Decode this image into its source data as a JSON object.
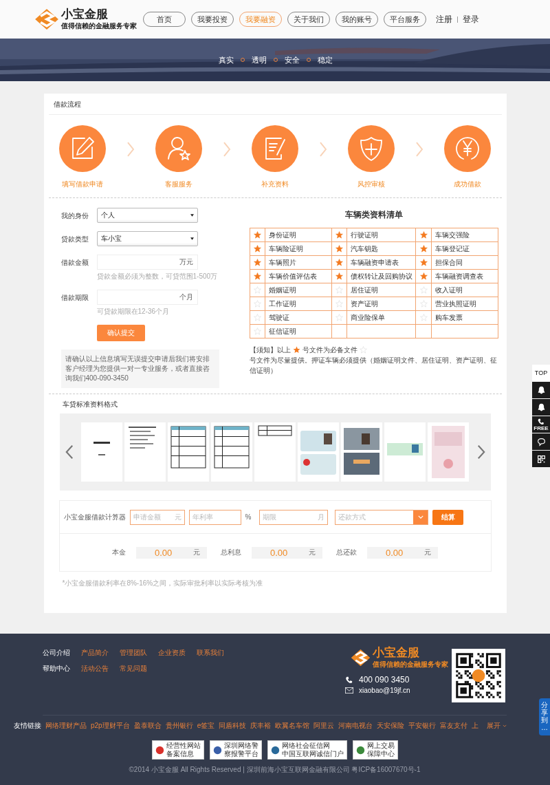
{
  "header": {
    "logo": {
      "name": "小宝金服",
      "slogan": "值得信赖的金融服务专家"
    },
    "nav": [
      {
        "label": "首页",
        "selected": false
      },
      {
        "label": "我要投资",
        "selected": false
      },
      {
        "label": "我要融资",
        "selected": true
      },
      {
        "label": "关于我们",
        "selected": false
      },
      {
        "label": "我的账号",
        "selected": false
      },
      {
        "label": "平台服务",
        "selected": false
      }
    ],
    "register": "注册",
    "login": "登录"
  },
  "banner": {
    "tags": [
      "真实",
      "透明",
      "安全",
      "稳定"
    ]
  },
  "process": {
    "title": "借款流程",
    "steps": [
      {
        "kind": "edit",
        "label": "填写借款申请"
      },
      {
        "kind": "service",
        "label": "客服服务"
      },
      {
        "kind": "document",
        "label": "补充资料"
      },
      {
        "kind": "shield",
        "label": "风控审核"
      },
      {
        "kind": "yen",
        "label": "成功借款"
      }
    ]
  },
  "form": {
    "fields": [
      {
        "kind": "select",
        "label": "我的身份",
        "value": "个人"
      },
      {
        "kind": "select",
        "label": "贷款类型",
        "value": "车小宝"
      },
      {
        "kind": "input",
        "label": "借款金额",
        "unit": "万元",
        "hint": "贷款金额必须为整数，可贷范围1-500万"
      },
      {
        "kind": "input",
        "label": "借款期限",
        "unit": "个月",
        "hint": "可贷款期限在12-36个月"
      }
    ],
    "submit": "确认提交",
    "info": "请确认以上信息填写无误提交申请后我们将安排客户经理为您提供一对一专业服务，或者直接咨询我们400-090-3450"
  },
  "checklist": {
    "title": "车辆类资料清单",
    "items": [
      {
        "label": "身份证明",
        "required": true
      },
      {
        "label": "行驶证明",
        "required": true
      },
      {
        "label": "车辆交强险",
        "required": true
      },
      {
        "label": "车辆险证明",
        "required": true
      },
      {
        "label": "汽车钥匙",
        "required": true
      },
      {
        "label": "车辆登记证",
        "required": true
      },
      {
        "label": "车辆照片",
        "required": true
      },
      {
        "label": "车辆融资申请表",
        "required": true
      },
      {
        "label": "担保合同",
        "required": true
      },
      {
        "label": "车辆价值评估表",
        "required": true
      },
      {
        "label": "债权转让及回购协议",
        "required": true
      },
      {
        "label": "车辆融资调查表",
        "required": true
      },
      {
        "label": "婚姻证明",
        "required": false
      },
      {
        "label": "居住证明",
        "required": false
      },
      {
        "label": "收入证明",
        "required": false
      },
      {
        "label": "工作证明",
        "required": false
      },
      {
        "label": "资产证明",
        "required": false
      },
      {
        "label": "营业执照证明",
        "required": false
      },
      {
        "label": "驾驶证",
        "required": false
      },
      {
        "label": "商业险保单",
        "required": false
      },
      {
        "label": "购车发票",
        "required": false
      },
      {
        "label": "征信证明",
        "required": false
      }
    ],
    "notice": {
      "before": "【须知】以上",
      "middle": "号文件为必备文件",
      "after": "号文件为尽量提供。押证车辆必须提供（婚姻证明文件、居住证明、资产证明、征信证明）"
    }
  },
  "gallery": {
    "title": "车贷标准资料格式"
  },
  "calculator": {
    "title": "小宝金服借款计算器",
    "amount": {
      "placeholder": "申请金额",
      "unit": "元"
    },
    "rate": {
      "placeholder": "年利率",
      "unit": "%"
    },
    "term": {
      "placeholder": "期限",
      "unit": "月"
    },
    "method": {
      "placeholder": "还款方式"
    },
    "button": "结算",
    "results": [
      {
        "label": "本金",
        "value": "0.00",
        "unit": "元"
      },
      {
        "label": "总利息",
        "value": "0.00",
        "unit": "元"
      },
      {
        "label": "总还款",
        "value": "0.00",
        "unit": "元"
      }
    ],
    "note": "*小宝金服借款利率在8%-16%之间，实际审批利率以实际考核为准"
  },
  "footer": {
    "link_rows": [
      {
        "head": "公司介绍",
        "links": [
          "产品简介",
          "管理团队",
          "企业资质",
          "联系我们"
        ]
      },
      {
        "head": "帮助中心",
        "links": [
          "活动公告",
          "常见问题"
        ]
      }
    ],
    "logo": {
      "name": "小宝金服",
      "slogan": "值得信赖的金融服务专家"
    },
    "phone": "400 090 3450",
    "email": "xiaobao@19jf.cn",
    "friends": {
      "head": "友情链接",
      "links": [
        "网络理财产品",
        "p2p理财平台",
        "盈泰联合",
        "贵州银行",
        "e签宝",
        "同盾科技",
        "庆丰裕",
        "欧翼名车馆",
        "阿里云",
        "河南电视台",
        "天安保险",
        "平安银行",
        "富友支付",
        "上"
      ],
      "more": "展开"
    },
    "badges": [
      {
        "lines": [
          "经营性网站",
          "备案信息"
        ]
      },
      {
        "lines": [
          "深圳网络警",
          "察报警平台"
        ]
      },
      {
        "lines": [
          "网络社会征信网",
          "中国互联网诚信门户"
        ]
      },
      {
        "lines": [
          "网上交易",
          "保障中心"
        ]
      }
    ],
    "copyright": "©2014 小宝金服 All Rights Reserved | 深圳前海小宝互联网金融有限公司 粤ICP备16007670号-1"
  },
  "side_tools": [
    {
      "kind": "top",
      "label": "TOP"
    },
    {
      "kind": "qq"
    },
    {
      "kind": "qq"
    },
    {
      "kind": "phone",
      "label": "FREE"
    },
    {
      "kind": "chat"
    },
    {
      "kind": "qr"
    }
  ],
  "share": {
    "label": "分享到…"
  }
}
